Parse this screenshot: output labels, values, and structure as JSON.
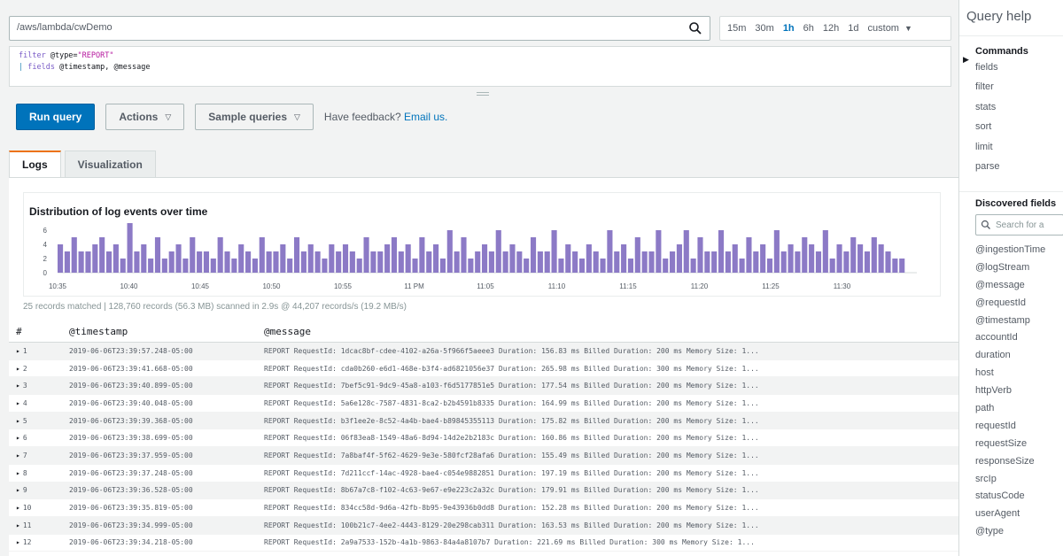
{
  "query": {
    "log_group": "/aws/lambda/cwDemo",
    "time_ranges": [
      "15m",
      "30m",
      "1h",
      "6h",
      "12h",
      "1d",
      "custom"
    ],
    "selected_range": "1h",
    "editor_line1_kw": "filter",
    "editor_line1_rest": " @type=",
    "editor_line1_str": "\"REPORT\"",
    "editor_line2_bar": "| ",
    "editor_line2_kw": "fields",
    "editor_line2_rest": " @timestamp, @message"
  },
  "actions": {
    "run_query": "Run query",
    "actions": "Actions",
    "sample_queries": "Sample queries",
    "feedback_text": "Have feedback?",
    "feedback_link": "Email us."
  },
  "tabs": [
    "Logs",
    "Visualization"
  ],
  "chart_data": {
    "type": "bar",
    "title": "Distribution of log events over time",
    "xlabel": "",
    "ylabel": "",
    "ylim": [
      0,
      7
    ],
    "yticks": [
      0,
      2,
      4,
      6
    ],
    "xticks": [
      "10:35",
      "10:40",
      "10:45",
      "10:50",
      "10:55",
      "11 PM",
      "11:05",
      "11:10",
      "11:15",
      "11:20",
      "11:25",
      "11:30"
    ],
    "values": [
      4,
      3,
      5,
      3,
      3,
      4,
      5,
      3,
      4,
      2,
      7,
      3,
      4,
      2,
      5,
      2,
      3,
      4,
      2,
      5,
      3,
      3,
      2,
      5,
      3,
      2,
      4,
      3,
      2,
      5,
      3,
      3,
      4,
      2,
      5,
      3,
      4,
      3,
      2,
      4,
      3,
      4,
      3,
      2,
      5,
      3,
      3,
      4,
      5,
      3,
      4,
      2,
      5,
      3,
      4,
      2,
      6,
      3,
      5,
      2,
      3,
      4,
      3,
      6,
      3,
      4,
      3,
      2,
      5,
      3,
      3,
      6,
      2,
      4,
      3,
      2,
      4,
      3,
      2,
      6,
      3,
      4,
      2,
      5,
      3,
      3,
      6,
      2,
      3,
      4,
      6,
      2,
      5,
      3,
      3,
      6,
      3,
      4,
      2,
      5,
      3,
      4,
      2,
      6,
      3,
      4,
      3,
      5,
      4,
      3,
      6,
      2,
      4,
      3,
      5,
      4,
      3,
      5,
      4,
      3,
      2,
      2
    ],
    "color": "#8c7ac6"
  },
  "summary": "25 records matched | 128,760 records (56.3 MB) scanned in 2.9s @ 44,207 records/s (19.2 MB/s)",
  "table": {
    "headers": [
      "#",
      "@timestamp",
      "@message"
    ],
    "rows": [
      {
        "n": "1",
        "ts": "2019-06-06T23:39:57.248-05:00",
        "msg": "REPORT RequestId: 1dcac8bf-cdee-4102-a26a-5f966f5aeee3 Duration: 156.83 ms Billed Duration: 200 ms Memory Size: 1..."
      },
      {
        "n": "2",
        "ts": "2019-06-06T23:39:41.668-05:00",
        "msg": "REPORT RequestId: cda0b260-e6d1-468e-b3f4-ad6821056e37 Duration: 265.98 ms Billed Duration: 300 ms Memory Size: 1..."
      },
      {
        "n": "3",
        "ts": "2019-06-06T23:39:40.899-05:00",
        "msg": "REPORT RequestId: 7bef5c91-9dc9-45a8-a103-f6d5177851e5 Duration: 177.54 ms Billed Duration: 200 ms Memory Size: 1..."
      },
      {
        "n": "4",
        "ts": "2019-06-06T23:39:40.048-05:00",
        "msg": "REPORT RequestId: 5a6e128c-7587-4831-8ca2-b2b4591b8335 Duration: 164.99 ms Billed Duration: 200 ms Memory Size: 1..."
      },
      {
        "n": "5",
        "ts": "2019-06-06T23:39:39.368-05:00",
        "msg": "REPORT RequestId: b3f1ee2e-8c52-4a4b-bae4-b89845355113 Duration: 175.82 ms Billed Duration: 200 ms Memory Size: 1..."
      },
      {
        "n": "6",
        "ts": "2019-06-06T23:39:38.699-05:00",
        "msg": "REPORT RequestId: 06f83ea8-1549-48a6-8d94-14d2e2b2183c Duration: 160.86 ms Billed Duration: 200 ms Memory Size: 1..."
      },
      {
        "n": "7",
        "ts": "2019-06-06T23:39:37.959-05:00",
        "msg": "REPORT RequestId: 7a8baf4f-5f62-4629-9e3e-580fcf28afa6 Duration: 155.49 ms Billed Duration: 200 ms Memory Size: 1..."
      },
      {
        "n": "8",
        "ts": "2019-06-06T23:39:37.248-05:00",
        "msg": "REPORT RequestId: 7d211ccf-14ac-4928-bae4-c054e9882851 Duration: 197.19 ms Billed Duration: 200 ms Memory Size: 1..."
      },
      {
        "n": "9",
        "ts": "2019-06-06T23:39:36.528-05:00",
        "msg": "REPORT RequestId: 8b67a7c8-f102-4c63-9e67-e9e223c2a32c Duration: 179.91 ms Billed Duration: 200 ms Memory Size: 1..."
      },
      {
        "n": "10",
        "ts": "2019-06-06T23:39:35.819-05:00",
        "msg": "REPORT RequestId: 834cc58d-9d6a-42fb-8b95-9e43936b0dd8 Duration: 152.28 ms Billed Duration: 200 ms Memory Size: 1..."
      },
      {
        "n": "11",
        "ts": "2019-06-06T23:39:34.999-05:00",
        "msg": "REPORT RequestId: 100b21c7-4ee2-4443-8129-20e298cab311 Duration: 163.53 ms Billed Duration: 200 ms Memory Size: 1..."
      },
      {
        "n": "12",
        "ts": "2019-06-06T23:39:34.218-05:00",
        "msg": "REPORT RequestId: 2a9a7533-152b-4a1b-9863-84a4a8107b7 Duration: 221.69 ms Billed Duration: 300 ms Memory Size: 1..."
      }
    ]
  },
  "help": {
    "title": "Query help",
    "commands_title": "Commands",
    "commands": [
      "fields",
      "filter",
      "stats",
      "sort",
      "limit",
      "parse"
    ],
    "fields_title": "Discovered fields",
    "fields_search_placeholder": "Search for a",
    "fields": [
      "@ingestionTime",
      "@logStream",
      "@message",
      "@requestId",
      "@timestamp",
      "accountId",
      "duration",
      "host",
      "httpVerb",
      "path",
      "requestId",
      "requestSize",
      "responseSize",
      "srcIp",
      "statusCode",
      "userAgent",
      "@type"
    ]
  }
}
